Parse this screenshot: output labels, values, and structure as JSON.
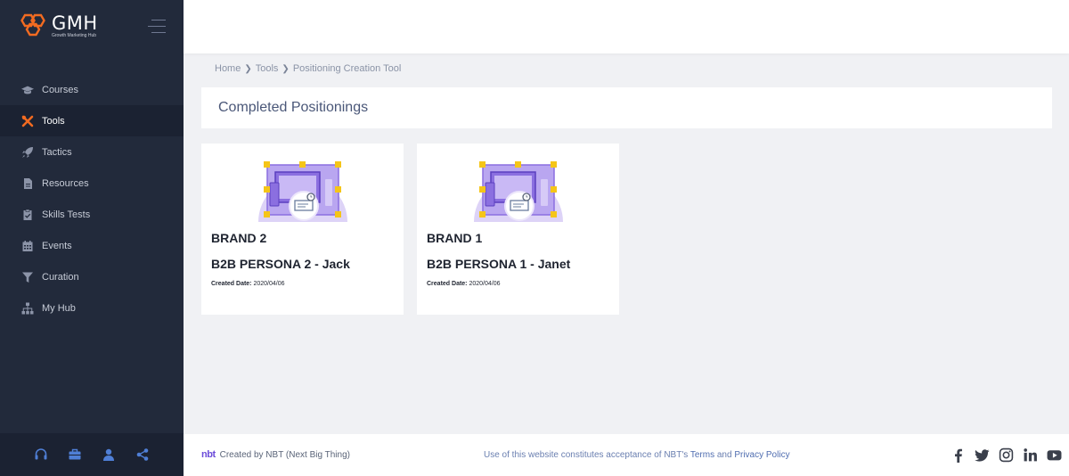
{
  "brand": {
    "name": "GMH",
    "tagline": "Growth Marketing Hub"
  },
  "sidebar": {
    "items": [
      {
        "label": "Courses",
        "icon": "graduation-cap-icon"
      },
      {
        "label": "Tools",
        "icon": "tools-icon",
        "active": true
      },
      {
        "label": "Tactics",
        "icon": "rocket-icon"
      },
      {
        "label": "Resources",
        "icon": "file-icon"
      },
      {
        "label": "Skills Tests",
        "icon": "clipboard-check-icon"
      },
      {
        "label": "Events",
        "icon": "calendar-icon"
      },
      {
        "label": "Curation",
        "icon": "filter-icon"
      },
      {
        "label": "My Hub",
        "icon": "sitemap-icon"
      }
    ],
    "footer_icons": [
      "headset-icon",
      "briefcase-icon",
      "user-icon",
      "share-icon"
    ]
  },
  "breadcrumb": {
    "home": "Home",
    "tools": "Tools",
    "current": "Positioning Creation Tool"
  },
  "page": {
    "title": "Completed Positionings"
  },
  "cards": [
    {
      "brand": "BRAND 2",
      "persona": "B2B PERSONA 2 - Jack",
      "date_label": "Created Date:",
      "date": "2020/04/06"
    },
    {
      "brand": "BRAND 1",
      "persona": "B2B PERSONA 1 - Janet",
      "date_label": "Created Date:",
      "date": "2020/04/06"
    }
  ],
  "footer": {
    "logo": "nbt",
    "created_by": "Created by  NBT (Next Big Thing)",
    "terms_prefix": "Use of this website constitutes acceptance of NBT's ",
    "terms_link": "Terms",
    "and": " and ",
    "privacy_link": "Privacy Policy",
    "socials": [
      "facebook-icon",
      "twitter-icon",
      "instagram-icon",
      "linkedin-icon",
      "youtube-icon"
    ]
  },
  "colors": {
    "sidebar_bg": "#222a3b",
    "accent_orange": "#f26b21",
    "illustration_purple": "#8b6fe0",
    "illustration_yellow": "#f5c518"
  }
}
